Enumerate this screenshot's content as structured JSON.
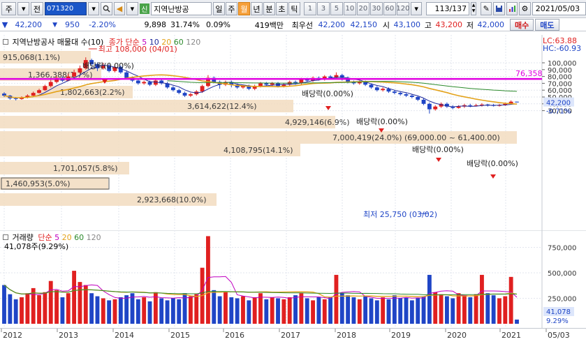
{
  "toolbar": {
    "market": "주",
    "prev_label": "전",
    "code": "071320",
    "speaker": "◀",
    "sin_badge": "신",
    "stock_name": "지역난방공",
    "periods": [
      "일",
      "주",
      "월",
      "년",
      "분",
      "초",
      "틱"
    ],
    "active_period": "월",
    "intervals": [
      "1",
      "3",
      "5",
      "10",
      "20",
      "30",
      "60",
      "120"
    ],
    "pager": "113/137",
    "date": "2021/05/03"
  },
  "info": {
    "price": "42,200",
    "change": "950",
    "change_pct": "-2.20%",
    "volume": "9,898",
    "turnover_ratio": "31.74%",
    "ratio": "0.09%",
    "amount": "419백만",
    "best_bid_label": "최우선",
    "bid1": "42,200",
    "bid2": "42,150",
    "open_label": "시",
    "open": "43,100",
    "high_label": "고",
    "high": "43,200",
    "low_label": "저",
    "low": "42,000",
    "buy": "매수",
    "sell": "매도"
  },
  "price_panel": {
    "legend_title": "지역난방공사 매물대 수(10)",
    "legend_ma_label": "종가 단순",
    "legend_ma": [
      "5",
      "10",
      "20",
      "60",
      "120"
    ],
    "lc": "LC:63.88",
    "hc": "HC:-60.93",
    "hline_label": "76,358",
    "current_price": "42,200",
    "current_change": "-0.71%",
    "y_ticks": [
      "100,000",
      "90,000",
      "80,000",
      "70,000",
      "60,000",
      "50,000",
      "40,000",
      "30,000"
    ],
    "max_label": "최고 108,000 (04/01)",
    "min_label": "최저 25,750 (03/02)",
    "dividend_label": "배당락(0.00%)",
    "volume_profile": [
      {
        "label": "915,068(1.1%)"
      },
      {
        "label": "1,366,388(1.7%)"
      },
      {
        "label": "1,802,663(2.2%)"
      },
      {
        "label": "3,614,622(12.4%)"
      },
      {
        "label": "4,929,146(6.9%)"
      },
      {
        "label": "7,000,419(24.0%) (69,000.00 ~ 61,400.00)"
      },
      {
        "label": "4,108,795(14.1%)"
      },
      {
        "label": "1,701,057(5.8%)"
      },
      {
        "label": "1,460,953(5.0%)"
      },
      {
        "label": "2,923,668(10.0%)"
      }
    ]
  },
  "volume_panel": {
    "legend_title": "거래량",
    "legend_ma_label": "단순",
    "legend_ma": [
      "5",
      "20",
      "60",
      "120"
    ],
    "last_volume": "41,078주(9.29%)",
    "y_ticks": [
      "750,000",
      "500,000",
      "250,000"
    ],
    "current_value": "41,078",
    "current_pct": "9.29%"
  },
  "x_axis": {
    "labels": [
      "2012",
      "2013",
      "2014",
      "2015",
      "2016",
      "2017",
      "2018",
      "2019",
      "2020",
      "2021",
      "05/03"
    ]
  },
  "colors": {
    "up": "#e02020",
    "down": "#1f45c6",
    "ma5": "#1f2a9c",
    "ma10": "#1f2a9c",
    "ma20": "#e3a21a",
    "ma60": "#2c8a2c",
    "hline": "#e000e0",
    "profile": "#f2dcc0"
  }
}
